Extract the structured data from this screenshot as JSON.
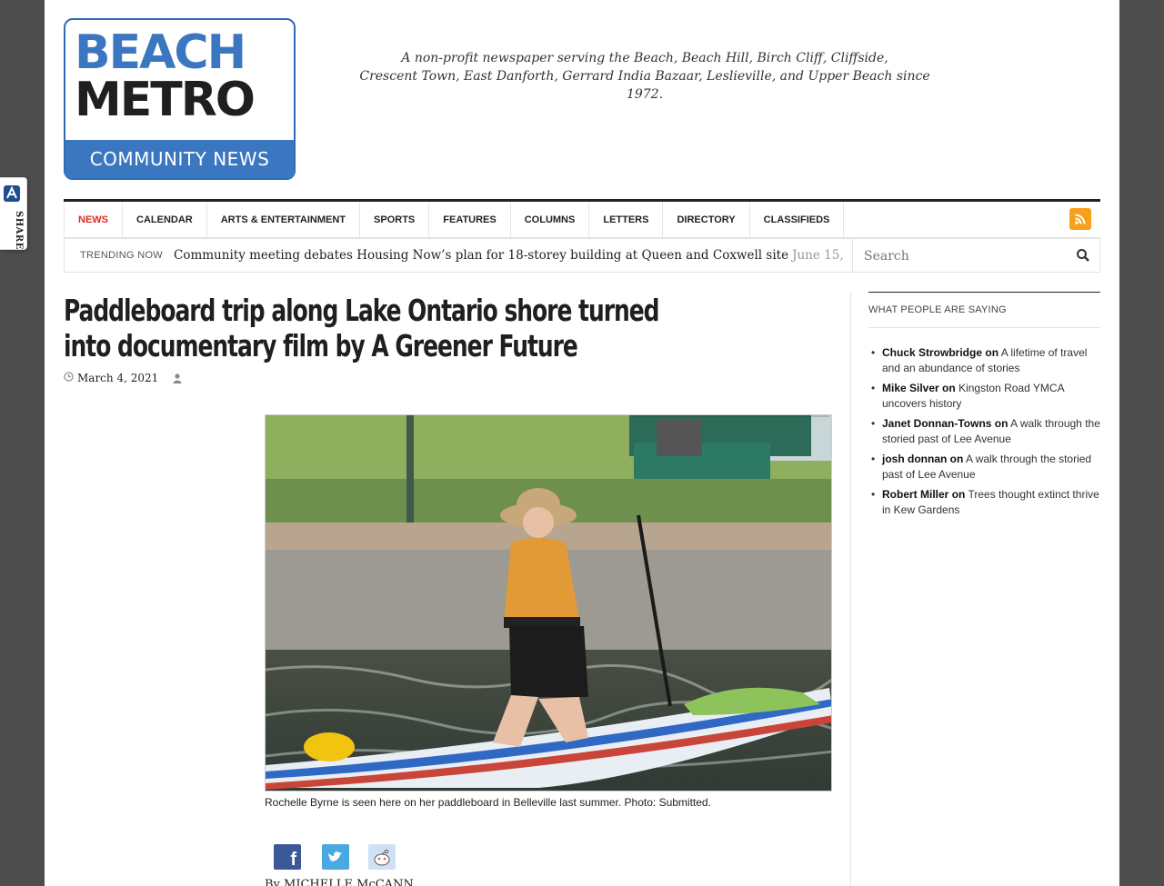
{
  "share_tab": {
    "label": "SHARE"
  },
  "logo": {
    "line1": "BEACH",
    "line2": "METRO",
    "line3": "COMMUNITY NEWS"
  },
  "tagline": {
    "line1": "A non-profit newspaper serving the Beach, Beach Hill, Birch Cliff, Cliffside,",
    "line2": "Crescent Town, East Danforth, Gerrard India Bazaar, Leslieville, and Upper Beach since 1972."
  },
  "nav": {
    "items": [
      {
        "label": "NEWS",
        "active": true
      },
      {
        "label": "CALENDAR"
      },
      {
        "label": "ARTS & ENTERTAINMENT"
      },
      {
        "label": "SPORTS"
      },
      {
        "label": "FEATURES"
      },
      {
        "label": "COLUMNS"
      },
      {
        "label": "LETTERS"
      },
      {
        "label": "DIRECTORY"
      },
      {
        "label": "CLASSIFIEDS"
      }
    ]
  },
  "trending": {
    "label": "TRENDING NOW",
    "headline": "Community meeting debates Housing Now’s plan for 18-storey building at Queen and Coxwell site",
    "date": "June 15,"
  },
  "search": {
    "placeholder": "Search"
  },
  "article": {
    "title": "Paddleboard trip along Lake Ontario shore turned into documentary film by A Greener Future",
    "date": "March 4, 2021",
    "caption": "Rochelle Byrne is seen here on her paddleboard in Belleville last summer. Photo: Submitted.",
    "byline": "By MICHELLE McCANN"
  },
  "sidebar": {
    "heading": "WHAT PEOPLE ARE SAYING",
    "comments": [
      {
        "author": "Chuck Strowbridge",
        "on": "on",
        "post": "A lifetime of travel and an abundance of stories"
      },
      {
        "author": "Mike Silver",
        "on": "on",
        "post": "Kingston Road YMCA uncovers history"
      },
      {
        "author": "Janet Donnan-Towns",
        "on": "on",
        "post": "A walk through the storied past of Lee Avenue"
      },
      {
        "author": "josh donnan",
        "on": "on",
        "post": "A walk through the storied past of Lee Avenue"
      },
      {
        "author": "Robert Miller",
        "on": "on",
        "post": "Trees thought extinct thrive in Kew Gardens"
      }
    ]
  },
  "colors": {
    "brand_blue": "#3a77c0",
    "nav_active": "#e02a20",
    "rss": "#f5a11c"
  }
}
